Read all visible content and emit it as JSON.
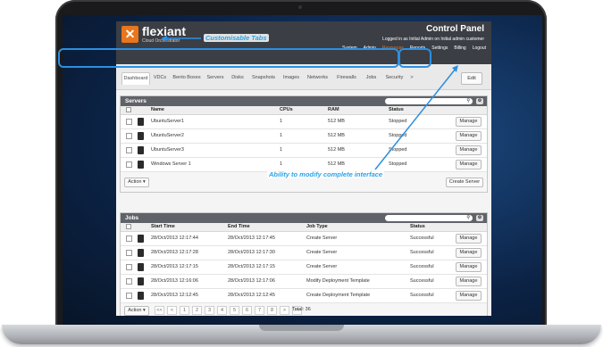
{
  "header": {
    "brand": "flexiant",
    "brand_sub": "Cloud Orchestrator",
    "title": "Control Panel",
    "login": "Logged in as Initial Admin on Initial admin customer",
    "nav": [
      "System",
      "Admin",
      "Resources",
      "Reports",
      "Settings",
      "Billing",
      "Logout"
    ],
    "nav_active": 2
  },
  "tabs": {
    "items": [
      "Dashboard",
      "VDCs",
      "Bento Boxes",
      "Servers",
      "Disks",
      "Snapshots",
      "Images",
      "Networks",
      "Firewalls",
      "Jobs",
      "Security",
      ">"
    ],
    "active": 0,
    "edit_label": "Edit"
  },
  "annotations": {
    "tabs": "Customisable Tabs",
    "interface": "Ability to modify complete interface"
  },
  "servers": {
    "title": "Servers",
    "columns": [
      "Name",
      "CPUs",
      "RAM",
      "Status"
    ],
    "rows": [
      {
        "name": "UbuntuServer1",
        "cpus": "1",
        "ram": "512 MB",
        "status": "Stopped",
        "action": "Manage"
      },
      {
        "name": "UbuntuServer2",
        "cpus": "1",
        "ram": "512 MB",
        "status": "Stopped",
        "action": "Manage"
      },
      {
        "name": "UbuntuServer3",
        "cpus": "1",
        "ram": "512 MB",
        "status": "Stopped",
        "action": "Manage"
      },
      {
        "name": "Windows Server 1",
        "cpus": "1",
        "ram": "512 MB",
        "status": "Stopped",
        "action": "Manage"
      }
    ],
    "action_label": "Action",
    "create_label": "Create Server"
  },
  "jobs": {
    "title": "Jobs",
    "columns": [
      "Start Time",
      "End Time",
      "Job Type",
      "Status"
    ],
    "rows": [
      {
        "start": "28/Oct/2013 12:17:44",
        "end": "28/Oct/2013 12:17:45",
        "type": "Create Server",
        "status": "Successful",
        "action": "Manage"
      },
      {
        "start": "28/Oct/2013 12:17:28",
        "end": "28/Oct/2013 12:17:30",
        "type": "Create Server",
        "status": "Successful",
        "action": "Manage"
      },
      {
        "start": "28/Oct/2013 12:17:15",
        "end": "28/Oct/2013 12:17:15",
        "type": "Create Server",
        "status": "Successful",
        "action": "Manage"
      },
      {
        "start": "28/Oct/2013 12:16:06",
        "end": "28/Oct/2013 12:17:06",
        "type": "Modify Deployment Template",
        "status": "Successful",
        "action": "Manage"
      },
      {
        "start": "28/Oct/2013 12:12:45",
        "end": "28/Oct/2013 12:12:45",
        "type": "Create Deployment Template",
        "status": "Successful",
        "action": "Manage"
      }
    ],
    "action_label": "Action",
    "pager": [
      "<<",
      "<",
      "1",
      "2",
      "3",
      "4",
      "5",
      "6",
      "7",
      "8",
      ">",
      ">>"
    ],
    "total": "Total: 36"
  }
}
